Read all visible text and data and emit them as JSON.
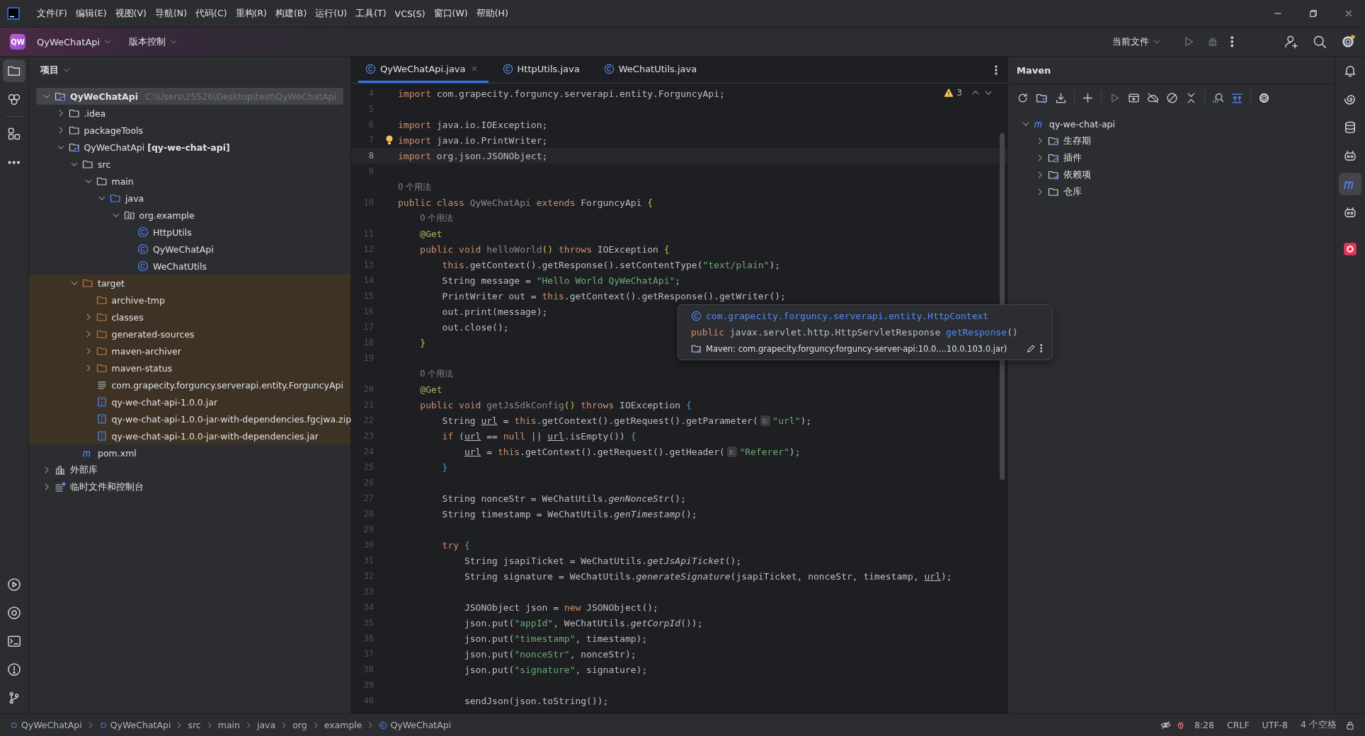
{
  "menu_bar": {
    "items": [
      "文件(F)",
      "编辑(E)",
      "视图(V)",
      "导航(N)",
      "代码(C)",
      "重构(R)",
      "构建(B)",
      "运行(U)",
      "工具(T)",
      "VCS(S)",
      "窗口(W)",
      "帮助(H)"
    ]
  },
  "toolbar": {
    "project_badge": "QW",
    "project_name": "QyWeChatApi",
    "vcs_label": "版本控制",
    "run_config": "当前文件"
  },
  "left_strip": {
    "top": [
      {
        "selected": true
      },
      {
        "selected": false
      },
      {
        "selected": false
      },
      {
        "selected": false
      }
    ],
    "bottom": [
      {
        "selected": false
      },
      {
        "selected": false
      },
      {
        "selected": false
      },
      {
        "selected": false
      },
      {
        "selected": false
      }
    ]
  },
  "project": {
    "title": "项目",
    "tree": [
      {
        "kind": "project",
        "label": "QyWeChatApi",
        "path": "C:\\Users\\25526\\Desktop\\test\\QyWeChatApi",
        "expanded": true,
        "selected": true,
        "children": [
          {
            "kind": "folder",
            "label": ".idea",
            "expanded": false,
            "selected": false
          },
          {
            "kind": "folder",
            "label": "packageTools",
            "expanded": false,
            "selected": false
          },
          {
            "kind": "module",
            "label": "QyWeChatApi **[qy-we-chat-api]**",
            "expanded": true,
            "selected": false,
            "children": [
              {
                "kind": "folder",
                "label": "src",
                "expanded": true,
                "selected": false,
                "children": [
                  {
                    "kind": "folder",
                    "label": "main",
                    "expanded": true,
                    "selected": false,
                    "children": [
                      {
                        "kind": "source",
                        "label": "java",
                        "expanded": true,
                        "selected": false,
                        "children": [
                          {
                            "kind": "package",
                            "label": "org.example",
                            "expanded": true,
                            "selected": false,
                            "children": [
                              {
                                "kind": "class",
                                "label": "HttpUtils",
                                "selected": false
                              },
                              {
                                "kind": "class",
                                "label": "QyWeChatApi",
                                "selected": false
                              },
                              {
                                "kind": "class",
                                "label": "WeChatUtils",
                                "selected": false
                              }
                            ]
                          }
                        ]
                      }
                    ]
                  }
                ]
              },
              {
                "kind": "folder",
                "label": "target",
                "expanded": true,
                "excluded": true,
                "selected": false,
                "children": [
                  {
                    "kind": "folder",
                    "label": "archive-tmp",
                    "selected": false
                  },
                  {
                    "kind": "folder",
                    "label": "classes",
                    "expanded": false,
                    "selected": false
                  },
                  {
                    "kind": "folder",
                    "label": "generated-sources",
                    "expanded": false,
                    "selected": false
                  },
                  {
                    "kind": "folder",
                    "label": "maven-archiver",
                    "expanded": false,
                    "selected": false
                  },
                  {
                    "kind": "folder",
                    "label": "maven-status",
                    "expanded": false,
                    "selected": false
                  },
                  {
                    "kind": "text",
                    "label": "com.grapecity.forguncy.serverapi.entity.ForguncyApi",
                    "selected": false
                  },
                  {
                    "kind": "jar",
                    "label": "qy-we-chat-api-1.0.0.jar",
                    "selected": false
                  },
                  {
                    "kind": "jar",
                    "label": "qy-we-chat-api-1.0.0-jar-with-dependencies.fgcjwa.zip",
                    "selected": false
                  },
                  {
                    "kind": "jar",
                    "label": "qy-we-chat-api-1.0.0-jar-with-dependencies.jar",
                    "selected": false
                  }
                ]
              },
              {
                "kind": "maven",
                "label": "pom.xml",
                "selected": false
              }
            ]
          }
        ]
      },
      {
        "kind": "library",
        "label": "外部库",
        "expanded": false,
        "selected": false
      },
      {
        "kind": "scratch",
        "label": "临时文件和控制台",
        "expanded": false,
        "selected": false
      }
    ]
  },
  "editor": {
    "tabs": [
      {
        "label": "QyWeChatApi.java",
        "selected": true
      },
      {
        "label": "HttpUtils.java",
        "selected": false
      },
      {
        "label": "WeChatUtils.java",
        "selected": false
      }
    ],
    "warnings": "3",
    "lines": [
      {
        "number": "4",
        "tokens": [
          {
            "kind": "keyword",
            "text": "import"
          },
          {
            "kind": "plain",
            "text": " com.grapecity.forguncy.serverapi.entity.ForguncyApi;"
          }
        ]
      },
      {
        "number": "5"
      },
      {
        "number": "6",
        "tokens": [
          {
            "kind": "keyword",
            "text": "import"
          },
          {
            "kind": "plain",
            "text": " java.io.IOException;"
          }
        ]
      },
      {
        "number": "7",
        "bulb": true,
        "tokens": [
          {
            "kind": "keyword",
            "text": "import"
          },
          {
            "kind": "plain",
            "text": " java.io.PrintWriter;"
          }
        ]
      },
      {
        "number": "8",
        "current": true,
        "tokens": [
          {
            "kind": "keyword",
            "text": "import"
          },
          {
            "kind": "plain",
            "text": " org.json.JSONObject;"
          }
        ]
      },
      {
        "number": "9"
      },
      {
        "tokens": [
          {
            "kind": "hint",
            "text": "0 个用法"
          }
        ]
      },
      {
        "number": "10",
        "tokens": [
          {
            "kind": "keyword",
            "text": "public class "
          },
          {
            "kind": "unused",
            "text": "QyWeChatApi"
          },
          {
            "kind": "keyword",
            "text": " extends "
          },
          {
            "kind": "plain",
            "text": "ForguncyApi "
          },
          {
            "kind": "paren",
            "text": "{"
          }
        ]
      },
      {
        "tokens": [
          {
            "kind": "hint",
            "text": "    0 个用法"
          }
        ]
      },
      {
        "number": "11",
        "tokens": [
          {
            "kind": "annotation",
            "text": "    @Get"
          }
        ]
      },
      {
        "number": "12",
        "tokens": [
          {
            "kind": "keyword",
            "text": "    public void "
          },
          {
            "kind": "unused",
            "text": "helloWorld"
          },
          {
            "kind": "paren",
            "text": "()"
          },
          {
            "kind": "keyword",
            "text": " throws "
          },
          {
            "kind": "plain",
            "text": "IOException "
          },
          {
            "kind": "paren",
            "text": "{"
          }
        ]
      },
      {
        "number": "13",
        "tokens": [
          {
            "kind": "keyword",
            "text": "        this"
          },
          {
            "kind": "plain",
            "text": ".getContext().getResponse().setContentType("
          },
          {
            "kind": "string",
            "text": "\"text/plain\""
          },
          {
            "kind": "plain",
            "text": ");"
          }
        ]
      },
      {
        "number": "14",
        "tokens": [
          {
            "kind": "plain",
            "text": "        String message = "
          },
          {
            "kind": "string",
            "text": "\"Hello World QyWeChatApi\""
          },
          {
            "kind": "plain",
            "text": ";"
          }
        ]
      },
      {
        "number": "15",
        "tokens": [
          {
            "kind": "plain",
            "text": "        PrintWriter out = "
          },
          {
            "kind": "keyword",
            "text": "this"
          },
          {
            "kind": "plain",
            "text": ".getContext().getResponse().getWriter();"
          }
        ]
      },
      {
        "number": "16",
        "tokens": [
          {
            "kind": "plain",
            "text": "        out.print(message);"
          }
        ]
      },
      {
        "number": "17",
        "tokens": [
          {
            "kind": "plain",
            "text": "        out.close();"
          }
        ]
      },
      {
        "number": "18",
        "tokens": [
          {
            "kind": "paren",
            "text": "    }"
          }
        ]
      },
      {
        "number": "19"
      },
      {
        "tokens": [
          {
            "kind": "hint",
            "text": "    0 个用法"
          }
        ]
      },
      {
        "number": "20",
        "tokens": [
          {
            "kind": "annotation",
            "text": "    @Get"
          }
        ]
      },
      {
        "number": "21",
        "tokens": [
          {
            "kind": "keyword",
            "text": "    public void "
          },
          {
            "kind": "unused",
            "text": "getJsSdkConfig"
          },
          {
            "kind": "paren",
            "text": "()"
          },
          {
            "kind": "keyword",
            "text": " throws "
          },
          {
            "kind": "plain",
            "text": "IOException "
          },
          {
            "kind": "brace",
            "text": "{"
          }
        ]
      },
      {
        "number": "22",
        "tokens": [
          {
            "kind": "plain",
            "text": "        String "
          },
          {
            "kind": "variable",
            "text": "url"
          },
          {
            "kind": "plain",
            "text": " = "
          },
          {
            "kind": "keyword",
            "text": "this"
          },
          {
            "kind": "plain",
            "text": ".getContext().getRequest().getParameter("
          },
          {
            "kind": "inlay",
            "text": "s:"
          },
          {
            "kind": "string",
            "text": "\"url\""
          },
          {
            "kind": "plain",
            "text": ");"
          }
        ]
      },
      {
        "number": "23",
        "tokens": [
          {
            "kind": "keyword",
            "text": "        if "
          },
          {
            "kind": "plain",
            "text": "("
          },
          {
            "kind": "variable",
            "text": "url"
          },
          {
            "kind": "plain",
            "text": " == "
          },
          {
            "kind": "keyword",
            "text": "null"
          },
          {
            "kind": "plain",
            "text": " || "
          },
          {
            "kind": "variable",
            "text": "url"
          },
          {
            "kind": "plain",
            "text": ".isEmpty()) "
          },
          {
            "kind": "brace",
            "text": "{"
          }
        ]
      },
      {
        "number": "24",
        "tokens": [
          {
            "kind": "variable",
            "text": "            url"
          },
          {
            "kind": "plain",
            "text": " = "
          },
          {
            "kind": "keyword",
            "text": "this"
          },
          {
            "kind": "plain",
            "text": ".getContext().getRequest().getHeader("
          },
          {
            "kind": "inlay",
            "text": "s:"
          },
          {
            "kind": "string",
            "text": "\"Referer\""
          },
          {
            "kind": "plain",
            "text": ");"
          }
        ]
      },
      {
        "number": "25",
        "tokens": [
          {
            "kind": "brace",
            "text": "        }"
          }
        ]
      },
      {
        "number": "26"
      },
      {
        "number": "27",
        "tokens": [
          {
            "kind": "plain",
            "text": "        String nonceStr = WeChatUtils."
          },
          {
            "kind": "static",
            "text": "genNonceStr"
          },
          {
            "kind": "plain",
            "text": "();"
          }
        ]
      },
      {
        "number": "28",
        "tokens": [
          {
            "kind": "plain",
            "text": "        String timestamp = WeChatUtils."
          },
          {
            "kind": "static",
            "text": "genTimestamp"
          },
          {
            "kind": "plain",
            "text": "();"
          }
        ]
      },
      {
        "number": "29"
      },
      {
        "number": "30",
        "tokens": [
          {
            "kind": "keyword",
            "text": "        try "
          },
          {
            "kind": "brace",
            "text": "{"
          }
        ]
      },
      {
        "number": "31",
        "tokens": [
          {
            "kind": "plain",
            "text": "            String jsapiTicket = WeChatUtils."
          },
          {
            "kind": "static",
            "text": "getJsApiTicket"
          },
          {
            "kind": "plain",
            "text": "();"
          }
        ]
      },
      {
        "number": "32",
        "tokens": [
          {
            "kind": "plain",
            "text": "            String signature = WeChatUtils."
          },
          {
            "kind": "static",
            "text": "generateSignature"
          },
          {
            "kind": "plain",
            "text": "(jsapiTicket, nonceStr, timestamp, "
          },
          {
            "kind": "variable",
            "text": "url"
          },
          {
            "kind": "plain",
            "text": ");"
          }
        ]
      },
      {
        "number": "33"
      },
      {
        "number": "34",
        "tokens": [
          {
            "kind": "plain",
            "text": "            JSONObject json = "
          },
          {
            "kind": "keyword",
            "text": "new"
          },
          {
            "kind": "plain",
            "text": " JSONObject();"
          }
        ]
      },
      {
        "number": "35",
        "tokens": [
          {
            "kind": "plain",
            "text": "            json.put("
          },
          {
            "kind": "string",
            "text": "\"appId\""
          },
          {
            "kind": "plain",
            "text": ", WeChatUtils."
          },
          {
            "kind": "static",
            "text": "getCorpId"
          },
          {
            "kind": "plain",
            "text": "());"
          }
        ]
      },
      {
        "number": "36",
        "tokens": [
          {
            "kind": "plain",
            "text": "            json.put("
          },
          {
            "kind": "string",
            "text": "\"timestamp\""
          },
          {
            "kind": "plain",
            "text": ", timestamp);"
          }
        ]
      },
      {
        "number": "37",
        "tokens": [
          {
            "kind": "plain",
            "text": "            json.put("
          },
          {
            "kind": "string",
            "text": "\"nonceStr\""
          },
          {
            "kind": "plain",
            "text": ", nonceStr);"
          }
        ]
      },
      {
        "number": "38",
        "tokens": [
          {
            "kind": "plain",
            "text": "            json.put("
          },
          {
            "kind": "string",
            "text": "\"signature\""
          },
          {
            "kind": "plain",
            "text": ", signature);"
          }
        ]
      },
      {
        "number": "39"
      },
      {
        "number": "40",
        "tokens": [
          {
            "kind": "plain",
            "text": "            sendJson(json.toString());"
          }
        ]
      }
    ],
    "tooltip": {
      "class_name": "com.grapecity.forguncy.serverapi.entity.HttpContext",
      "modifier": "public",
      "return_type": "javax.servlet.http.HttpServletResponse",
      "method": "getResponse",
      "params": "()",
      "source": "Maven: com.grapecity.forguncy:forguncy-server-api:10.0....10.0.103.0.jar)"
    }
  },
  "maven": {
    "title": "Maven",
    "tree": [
      {
        "kind": "maven",
        "label": "qy-we-chat-api",
        "expanded": true,
        "children": [
          {
            "kind": "lifecycle",
            "label": "生存期",
            "expanded": false
          },
          {
            "kind": "plugins",
            "label": "插件",
            "expanded": false
          },
          {
            "kind": "dependencies",
            "label": "依赖项",
            "expanded": false
          },
          {
            "kind": "repositories",
            "label": "仓库",
            "expanded": false
          }
        ]
      }
    ]
  },
  "right_strip": [
    {
      "selected": false
    },
    {
      "selected": false
    },
    {
      "selected": false
    },
    {
      "selected": false
    },
    {
      "selected": true
    },
    {
      "selected": false
    },
    {
      "selected": false
    }
  ],
  "status_bar": {
    "breadcrumbs": [
      {
        "kind": "module",
        "label": "QyWeChatApi"
      },
      {
        "kind": "module",
        "label": "QyWeChatApi"
      },
      {
        "kind": "plain",
        "label": "src"
      },
      {
        "kind": "plain",
        "label": "main"
      },
      {
        "kind": "plain",
        "label": "java"
      },
      {
        "kind": "plain",
        "label": "org"
      },
      {
        "kind": "plain",
        "label": "example"
      },
      {
        "kind": "class",
        "label": "QyWeChatApi"
      }
    ],
    "position": "8:28",
    "line_separator": "CRLF",
    "encoding": "UTF-8",
    "indent": "4 个空格"
  }
}
